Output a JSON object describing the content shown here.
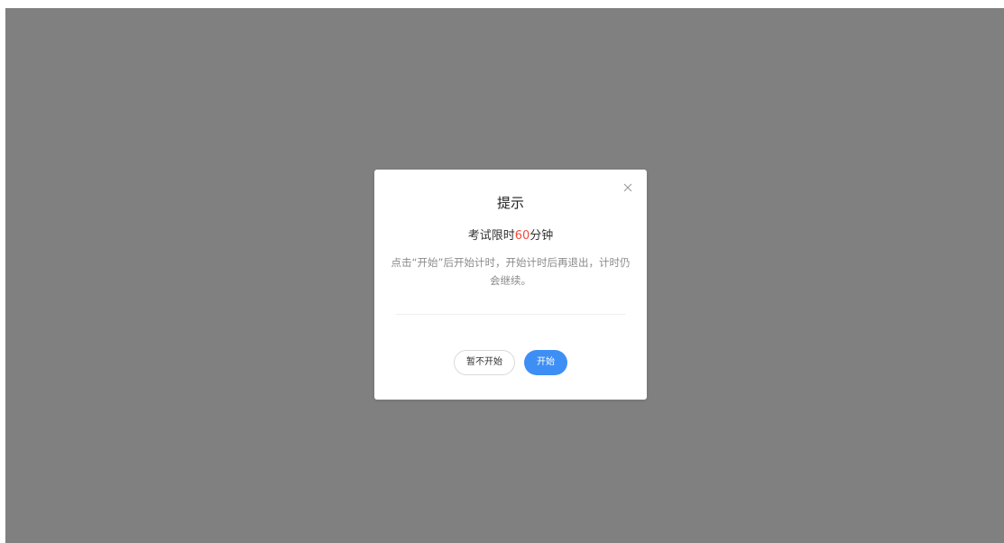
{
  "dialog": {
    "title": "提示",
    "limit_prefix": "考试限时",
    "limit_value": "60",
    "limit_suffix": "分钟",
    "description": "点击“开始”后开始计时，开始计时后再退出，计时仍会继续。",
    "close_icon": "close-icon",
    "cancel_label": "暂不开始",
    "start_label": "开始"
  },
  "colors": {
    "overlay": "#808080",
    "primary": "#3d8ff5",
    "accent": "#f04b3f"
  }
}
